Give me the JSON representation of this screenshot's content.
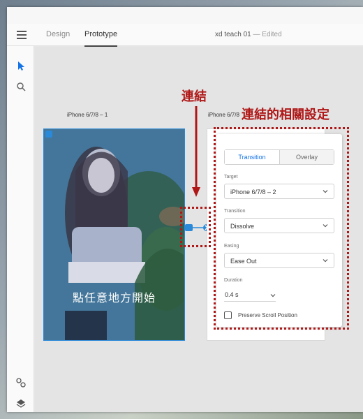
{
  "toolbar": {
    "tab_design": "Design",
    "tab_prototype": "Prototype",
    "doc_title": "xd teach 01",
    "doc_sep": "—",
    "doc_status": "Edited"
  },
  "leftbar": {
    "tools": [
      "select-icon",
      "zoom-icon"
    ],
    "bottom": [
      "plugins-icon",
      "layers-icon"
    ]
  },
  "canvas": {
    "artboard1_label": "iPhone 6/7/8 – 1",
    "artboard2_label": "iPhone 6/7/8",
    "artboard_text": "點任意地方開始"
  },
  "panel": {
    "tab_transition": "Transition",
    "tab_overlay": "Overlay",
    "target_label": "Target",
    "target_value": "iPhone 6/7/8 – 2",
    "transition_label": "Transition",
    "transition_value": "Dissolve",
    "easing_label": "Easing",
    "easing_value": "Ease Out",
    "duration_label": "Duration",
    "duration_value": "0.4 s",
    "preserve_label": "Preserve Scroll Position",
    "preserve_checked": false
  },
  "annotations": {
    "link_label": "連結",
    "settings_label": "連結的相關設定",
    "color": "#b01818"
  },
  "colors": {
    "accent": "#1473e6",
    "wire": "#2a89d8"
  }
}
